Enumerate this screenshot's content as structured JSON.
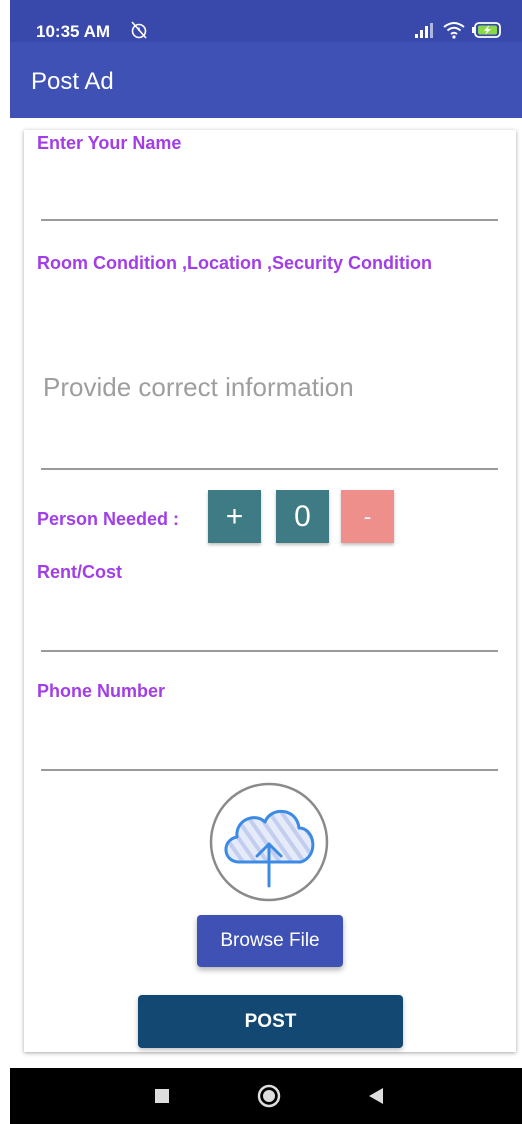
{
  "status_bar": {
    "time": "10:35 AM",
    "icons": [
      "alarm-off-icon",
      "signal-icon",
      "wifi-icon",
      "battery-charging-icon"
    ]
  },
  "app_bar": {
    "title": "Post Ad"
  },
  "form": {
    "name_label": "Enter Your Name",
    "name_value": "",
    "description_label": "Room Condition ,Location ,Security Condition",
    "description_placeholder": "Provide correct information",
    "person_needed_label": "Person Needed :",
    "person_increment_label": "+",
    "person_count": "0",
    "person_decrement_label": "-",
    "rent_label": "Rent/Cost",
    "rent_value": "",
    "phone_label": "Phone Number",
    "phone_value": "",
    "upload_icon": "cloud-upload-icon",
    "browse_label": "Browse File",
    "post_label": "POST"
  },
  "nav_bar": {
    "icons": [
      "recents-square-icon",
      "home-circle-icon",
      "back-triangle-icon"
    ]
  },
  "colors": {
    "status_bar": "#3949ab",
    "app_bar": "#3f51b5",
    "label": "#a23ee8",
    "stepper": "#3f7b85",
    "stepper_minus": "#ee8f8b",
    "browse_button": "#3f51b5",
    "post_button": "#124872"
  }
}
